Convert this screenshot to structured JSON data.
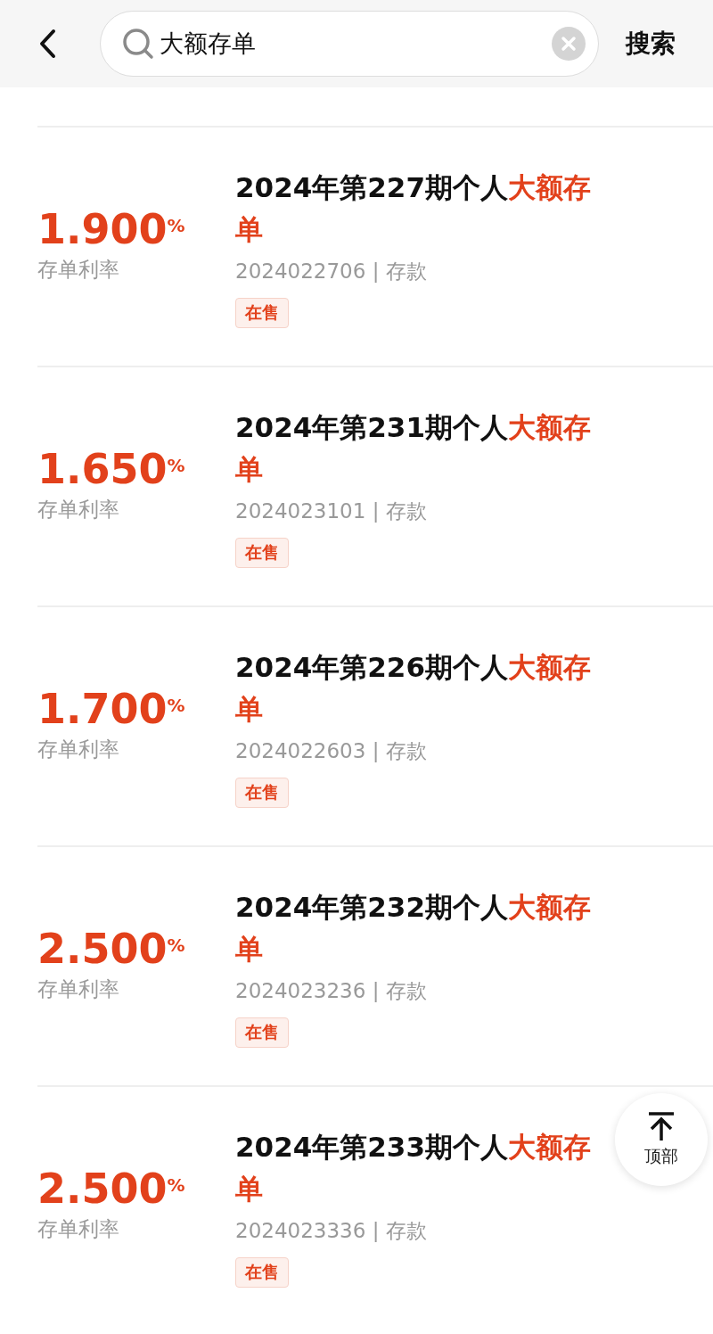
{
  "header": {
    "search": {
      "value": "大额存单"
    },
    "search_button": "搜索"
  },
  "products": [
    {
      "rate": "1.900",
      "percent": "%",
      "rate_label": "存单利率",
      "title": "2024年第227期个人",
      "highlight": "大额存单",
      "code": "2024022706",
      "separator": "|",
      "category": "存款",
      "status": "在售"
    },
    {
      "rate": "1.650",
      "percent": "%",
      "rate_label": "存单利率",
      "title": "2024年第231期个人",
      "highlight": "大额存单",
      "code": "2024023101",
      "separator": "|",
      "category": "存款",
      "status": "在售"
    },
    {
      "rate": "1.700",
      "percent": "%",
      "rate_label": "存单利率",
      "title": "2024年第226期个人",
      "highlight": "大额存单",
      "code": "2024022603",
      "separator": "|",
      "category": "存款",
      "status": "在售"
    },
    {
      "rate": "2.500",
      "percent": "%",
      "rate_label": "存单利率",
      "title": "2024年第232期个人",
      "highlight": "大额存单",
      "code": "2024023236",
      "separator": "|",
      "category": "存款",
      "status": "在售"
    },
    {
      "rate": "2.500",
      "percent": "%",
      "rate_label": "存单利率",
      "title": "2024年第233期个人",
      "highlight": "大额存单",
      "code": "2024023336",
      "separator": "|",
      "category": "存款",
      "status": "在售"
    }
  ],
  "back_to_top": "顶部"
}
